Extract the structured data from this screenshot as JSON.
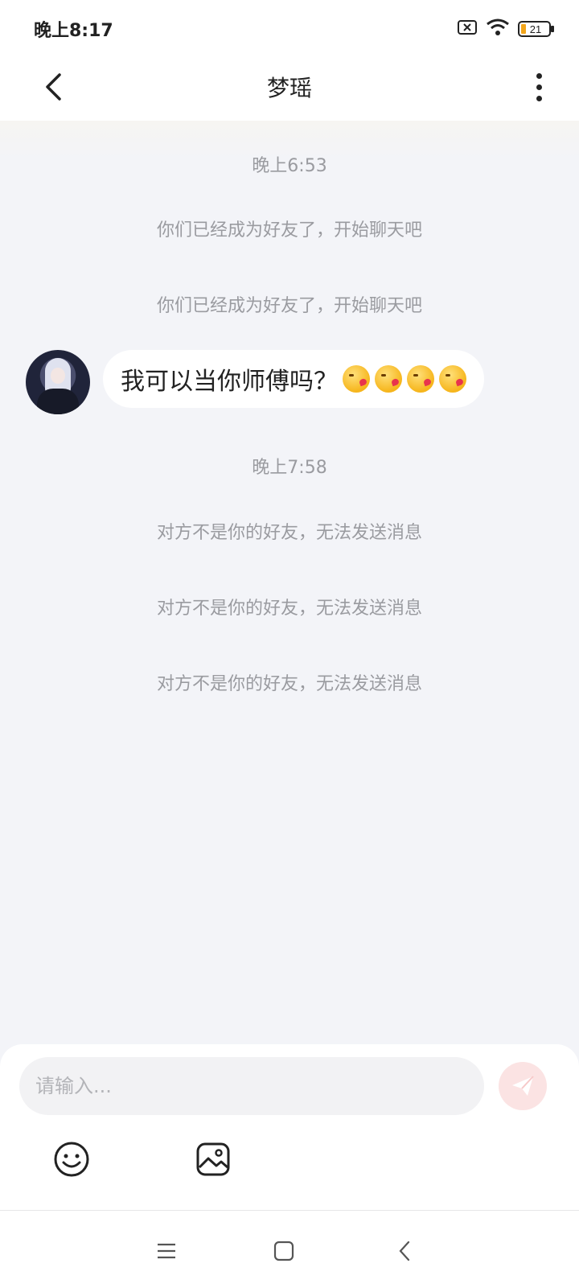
{
  "status_bar": {
    "time": "晚上8:17",
    "battery": "21",
    "icons": [
      "sim-off-icon",
      "wifi-icon",
      "battery-icon"
    ]
  },
  "header": {
    "back_icon": "chevron-left-icon",
    "title": "梦瑶",
    "more_icon": "more-vertical-icon"
  },
  "messages": {
    "ts1": "晚上6:53",
    "sys1": "你们已经成为好友了，开始聊天吧",
    "sys2": "你们已经成为好友了，开始聊天吧",
    "bubble_text": "我可以当你师傅吗？",
    "bubble_emojis": [
      "kissing-face-emoji",
      "kissing-face-emoji",
      "kissing-face-emoji",
      "kissing-face-emoji"
    ],
    "ts2": "晚上7:58",
    "sys3": "对方不是你的好友，无法发送消息",
    "sys4": "对方不是你的好友，无法发送消息",
    "sys5": "对方不是你的好友，无法发送消息"
  },
  "composer": {
    "placeholder": "请输入...",
    "value": "",
    "send_icon": "paper-plane-icon",
    "emoji_icon": "smiley-icon",
    "image_icon": "image-icon"
  },
  "colors": {
    "background": "#f3f4f8",
    "bubble": "#ffffff",
    "system_text": "#9a9ba0",
    "send_button": "#fbe3e3"
  }
}
